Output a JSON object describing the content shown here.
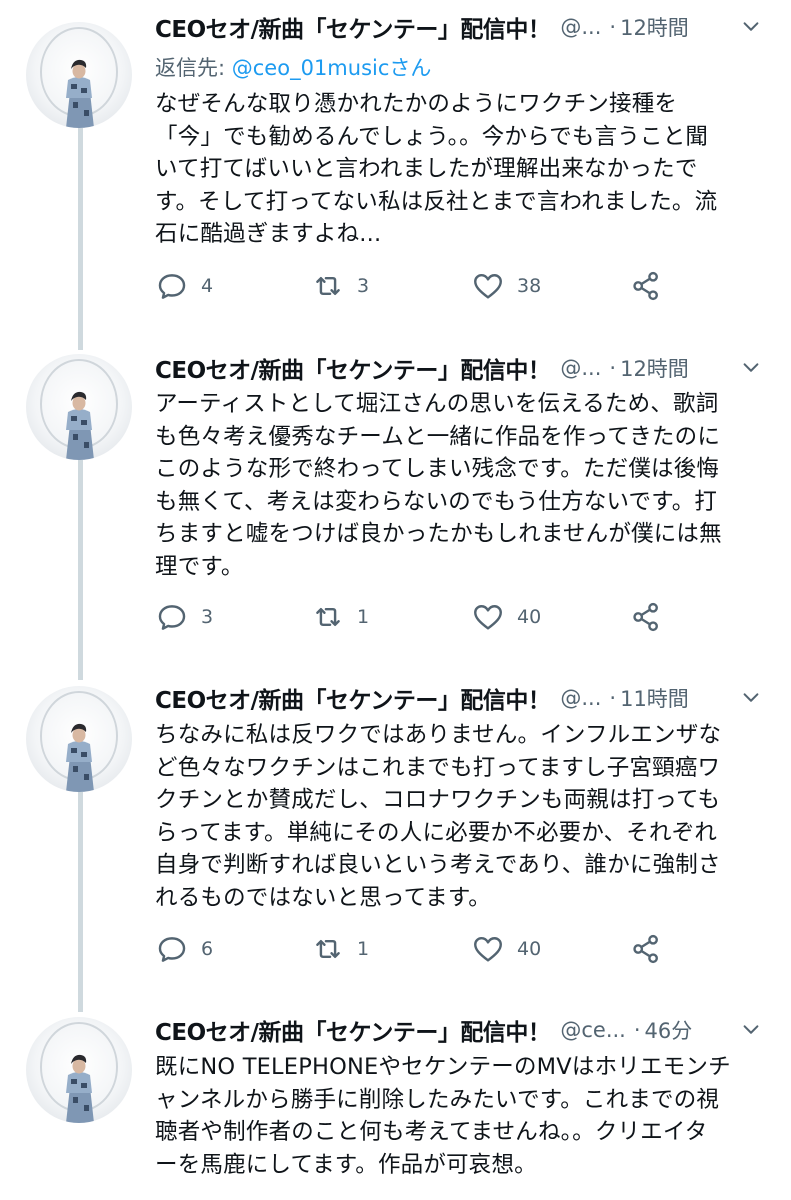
{
  "tweets": [
    {
      "name": "CEOセオ/新曲「セケンテー」配信中！",
      "handle": "@...",
      "dot": "·",
      "time": "12時間",
      "reply_prefix": "返信先: ",
      "reply_to": "@ceo_01musicさん",
      "lines": [
        "なぜそんな取り憑かれたかのようにワクチン接種を",
        "「今」でも勧めるんでしょう。。今からでも言うこと聞",
        "いて打てばいいと言われましたが理解出来なかったで",
        "す。そして打ってない私は反社とまで言われました。流",
        "石に酷過ぎますよね..."
      ],
      "replies": "4",
      "retweets": "3",
      "likes": "38"
    },
    {
      "name": "CEOセオ/新曲「セケンテー」配信中！",
      "handle": "@...",
      "dot": "·",
      "time": "12時間",
      "lines": [
        "アーティストとして堀江さんの思いを伝えるため、歌詞",
        "も色々考え優秀なチームと一緒に作品を作ってきたのに",
        "このような形で終わってしまい残念です。ただ僕は後悔",
        "も無くて、考えは変わらないのでもう仕方ないです。打",
        "ちますと嘘をつけば良かったかもしれませんが僕には無",
        "理です。"
      ],
      "replies": "3",
      "retweets": "1",
      "likes": "40"
    },
    {
      "name": "CEOセオ/新曲「セケンテー」配信中！",
      "handle": "@...",
      "dot": "·",
      "time": "11時間",
      "lines": [
        "ちなみに私は反ワクではありません。インフルエンザな",
        "ど色々なワクチンはこれまでも打ってますし子宮頸癌ワ",
        "クチンとか賛成だし、コロナワクチンも両親は打っても",
        "らってます。単純にその人に必要か不必要か、それぞれ",
        "自身で判断すれば良いという考えであり、誰かに強制さ",
        "れるものではないと思ってます。"
      ],
      "replies": "6",
      "retweets": "1",
      "likes": "40"
    },
    {
      "name": "CEOセオ/新曲「セケンテー」配信中！",
      "handle": "@ce...",
      "dot": "·",
      "time": "46分",
      "lines": [
        "既にNO TELEPHONEやセケンテーのMVはホリエモンチ",
        "ャンネルから勝手に削除したみたいです。これまでの視",
        "聴者や制作者のこと何も考えてませんね。。クリエイタ",
        "ーを馬鹿にしてます。作品が可哀想。"
      ]
    }
  ],
  "icons": {
    "reply": "speech-bubble-icon",
    "retweet": "retweet-arrows-icon",
    "like": "heart-outline-icon",
    "share": "share-nodes-icon",
    "more": "chevron-down-icon"
  },
  "colors": {
    "text": "#0f1419",
    "secondary": "#536471",
    "link": "#1d9bf0",
    "thread_line": "#cfd9de"
  }
}
